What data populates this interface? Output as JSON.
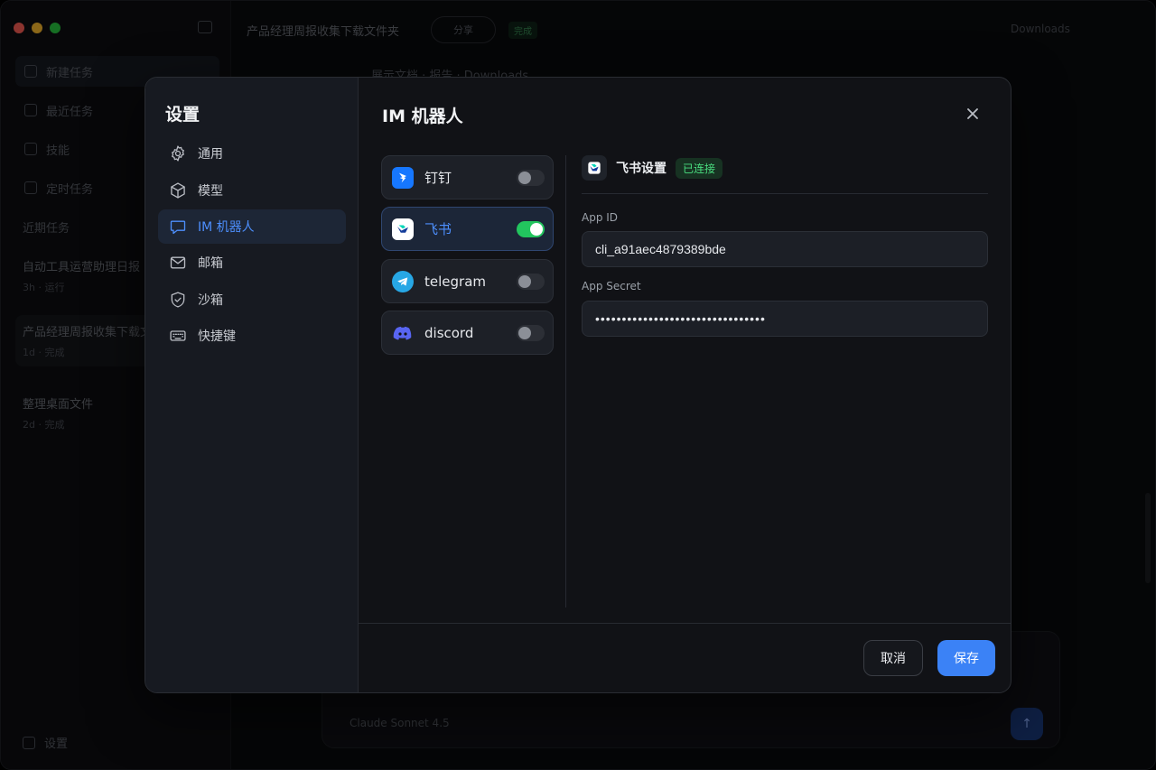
{
  "background": {
    "sidebar": {
      "items": [
        "新建任务",
        "最近任务",
        "技能",
        "定时任务"
      ],
      "section_label": "近期任务",
      "conversations": [
        {
          "title": "自动工具运营助理日报",
          "meta": "3h · 运行"
        },
        {
          "title": "产品经理周报收集下载文件夹",
          "meta": "1d · 完成"
        },
        {
          "title": "整理桌面文件",
          "meta": "2d · 完成"
        }
      ],
      "settings_label": "设置"
    },
    "header": {
      "title": "产品经理周报收集下载文件夹",
      "pill": "分享",
      "tag": "完成",
      "right_label": "Downloads"
    },
    "crumb": "展示文档 · 报告 · Downloads",
    "composer": {
      "model": "Claude Sonnet 4.5",
      "send_icon": "arrow-up-icon"
    }
  },
  "dialog": {
    "nav_title": "设置",
    "nav_items": [
      {
        "label": "通用",
        "icon": "gear-icon"
      },
      {
        "label": "模型",
        "icon": "cube-icon"
      },
      {
        "label": "IM 机器人",
        "icon": "chat-bubble-icon"
      },
      {
        "label": "邮箱",
        "icon": "mail-icon"
      },
      {
        "label": "沙箱",
        "icon": "shield-icon"
      },
      {
        "label": "快捷键",
        "icon": "keyboard-icon"
      }
    ],
    "active_nav": "IM 机器人",
    "title": "IM 机器人",
    "bots": [
      {
        "label": "钉钉",
        "icon": "dingtalk-icon",
        "enabled": false
      },
      {
        "label": "飞书",
        "icon": "feishu-icon",
        "enabled": true
      },
      {
        "label": "telegram",
        "icon": "telegram-icon",
        "enabled": false
      },
      {
        "label": "discord",
        "icon": "discord-icon",
        "enabled": false
      }
    ],
    "detail": {
      "title": "飞书设置",
      "status": "已连接",
      "app_id_label": "App ID",
      "app_id_value": "cli_a91aec4879389bde",
      "app_secret_label": "App Secret",
      "app_secret_value": "••••••••••••••••••••••••••••••••"
    },
    "cancel_label": "取消",
    "save_label": "保存"
  },
  "colors": {
    "accent": "#3b82f6",
    "toggle_on": "#22c55e",
    "badge_text": "#4ade80"
  }
}
